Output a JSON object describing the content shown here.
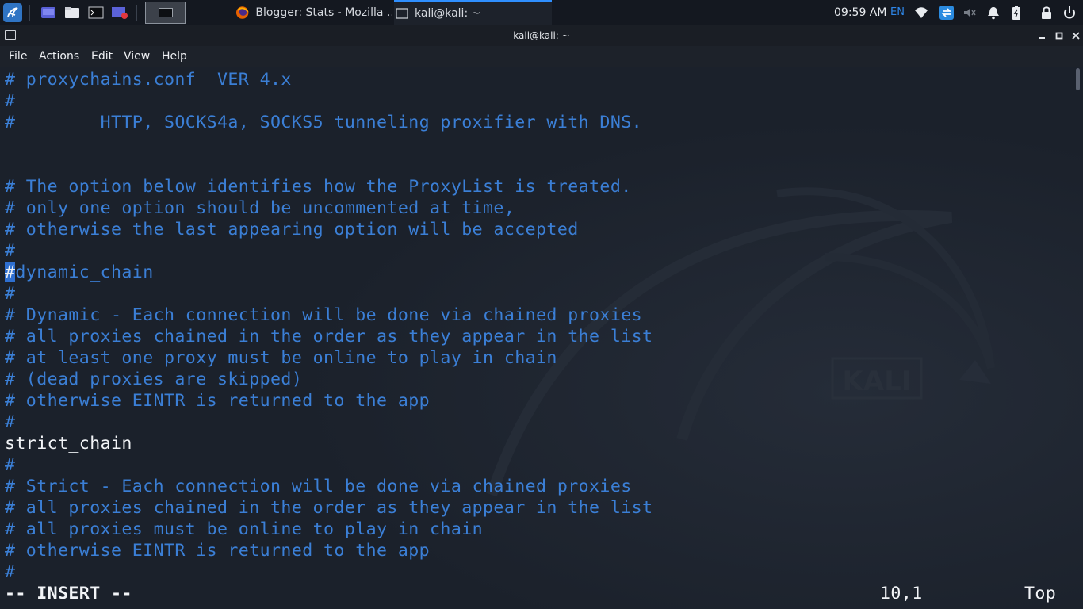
{
  "panel": {
    "workspace_label": "",
    "tasks": [
      {
        "label": "Blogger: Stats - Mozilla ...",
        "icon": "firefox-icon",
        "active": false
      },
      {
        "label": "kali@kali: ~",
        "icon": "terminal-icon",
        "active": true
      }
    ],
    "clock": "09:59 AM",
    "keyboard_layout": "EN",
    "accent_color": "#2f8fff"
  },
  "window": {
    "title": "kali@kali: ~"
  },
  "menu": {
    "file": "File",
    "actions": "Actions",
    "edit": "Edit",
    "view": "View",
    "help": "Help"
  },
  "editor": {
    "cursor_char": "#",
    "cursor_rest": "dynamic_chain",
    "lines": [
      "# proxychains.conf  VER 4.x",
      "#",
      "#        HTTP, SOCKS4a, SOCKS5 tunneling proxifier with DNS.",
      "",
      "",
      "# The option below identifies how the ProxyList is treated.",
      "# only one option should be uncommented at time,",
      "# otherwise the last appearing option will be accepted",
      "#",
      "",
      "#",
      "# Dynamic - Each connection will be done via chained proxies",
      "# all proxies chained in the order as they appear in the list",
      "# at least one proxy must be online to play in chain",
      "# (dead proxies are skipped)",
      "# otherwise EINTR is returned to the app",
      "#",
      "strict_chain",
      "#",
      "# Strict - Each connection will be done via chained proxies",
      "# all proxies chained in the order as they appear in the list",
      "# all proxies must be online to play in chain",
      "# otherwise EINTR is returned to the app",
      "#"
    ],
    "comment_color": "#3b7fd6",
    "text_color": "#f2f4f7"
  },
  "status": {
    "mode": "-- INSERT --",
    "position": "10,1",
    "scroll": "Top"
  }
}
